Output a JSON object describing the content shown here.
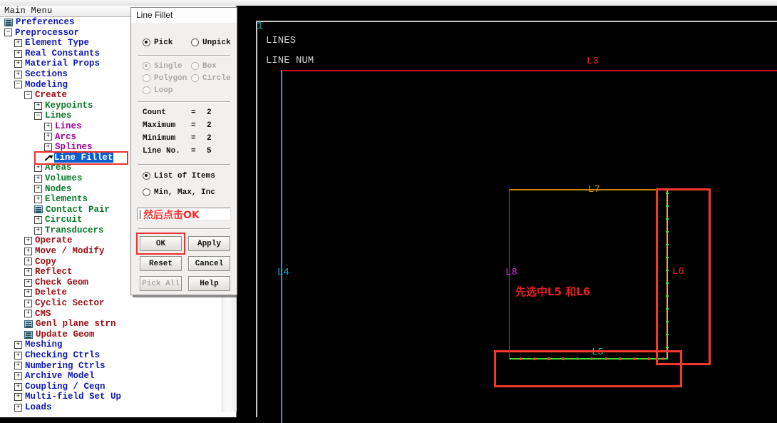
{
  "window": {
    "title": "Main Menu"
  },
  "tree": {
    "title": "Main Menu",
    "items": [
      {
        "label": "Preferences",
        "indent": 0,
        "icon": "module-icon",
        "color": "blue"
      },
      {
        "label": "Preprocessor",
        "indent": 0,
        "icon": "collapse-icon",
        "color": "blue"
      },
      {
        "label": "Element Type",
        "indent": 1,
        "icon": "expand-icon",
        "color": "blue"
      },
      {
        "label": "Real Constants",
        "indent": 1,
        "icon": "expand-icon",
        "color": "blue"
      },
      {
        "label": "Material Props",
        "indent": 1,
        "icon": "expand-icon",
        "color": "blue"
      },
      {
        "label": "Sections",
        "indent": 1,
        "icon": "expand-icon",
        "color": "blue"
      },
      {
        "label": "Modeling",
        "indent": 1,
        "icon": "collapse-icon",
        "color": "blue"
      },
      {
        "label": "Create",
        "indent": 2,
        "icon": "collapse-icon",
        "color": "darkred"
      },
      {
        "label": "Keypoints",
        "indent": 3,
        "icon": "expand-icon",
        "color": "green"
      },
      {
        "label": "Lines",
        "indent": 3,
        "icon": "collapse-icon",
        "color": "green"
      },
      {
        "label": "Lines",
        "indent": 4,
        "icon": "expand-icon",
        "color": "purple"
      },
      {
        "label": "Arcs",
        "indent": 4,
        "icon": "expand-icon",
        "color": "purple"
      },
      {
        "label": "Splines",
        "indent": 4,
        "icon": "expand-icon",
        "color": "purple"
      },
      {
        "label": "Line Fillet",
        "indent": 4,
        "icon": "pick-arrow-icon",
        "color": "purple",
        "selected": true
      },
      {
        "label": "Areas",
        "indent": 3,
        "icon": "expand-icon",
        "color": "green"
      },
      {
        "label": "Volumes",
        "indent": 3,
        "icon": "expand-icon",
        "color": "green"
      },
      {
        "label": "Nodes",
        "indent": 3,
        "icon": "expand-icon",
        "color": "green"
      },
      {
        "label": "Elements",
        "indent": 3,
        "icon": "expand-icon",
        "color": "green"
      },
      {
        "label": "Contact Pair",
        "indent": 3,
        "icon": "module-icon",
        "color": "green"
      },
      {
        "label": "Circuit",
        "indent": 3,
        "icon": "expand-icon",
        "color": "green"
      },
      {
        "label": "Transducers",
        "indent": 3,
        "icon": "expand-icon",
        "color": "green"
      },
      {
        "label": "Operate",
        "indent": 2,
        "icon": "expand-icon",
        "color": "darkred"
      },
      {
        "label": "Move / Modify",
        "indent": 2,
        "icon": "expand-icon",
        "color": "darkred"
      },
      {
        "label": "Copy",
        "indent": 2,
        "icon": "expand-icon",
        "color": "darkred"
      },
      {
        "label": "Reflect",
        "indent": 2,
        "icon": "expand-icon",
        "color": "darkred"
      },
      {
        "label": "Check Geom",
        "indent": 2,
        "icon": "expand-icon",
        "color": "darkred"
      },
      {
        "label": "Delete",
        "indent": 2,
        "icon": "expand-icon",
        "color": "darkred"
      },
      {
        "label": "Cyclic Sector",
        "indent": 2,
        "icon": "expand-icon",
        "color": "darkred"
      },
      {
        "label": "CMS",
        "indent": 2,
        "icon": "expand-icon",
        "color": "darkred"
      },
      {
        "label": "Genl plane strn",
        "indent": 2,
        "icon": "module-icon",
        "color": "darkred"
      },
      {
        "label": "Update Geom",
        "indent": 2,
        "icon": "module-icon",
        "color": "darkred"
      },
      {
        "label": "Meshing",
        "indent": 1,
        "icon": "expand-icon",
        "color": "blue"
      },
      {
        "label": "Checking Ctrls",
        "indent": 1,
        "icon": "expand-icon",
        "color": "blue"
      },
      {
        "label": "Numbering Ctrls",
        "indent": 1,
        "icon": "expand-icon",
        "color": "blue"
      },
      {
        "label": "Archive Model",
        "indent": 1,
        "icon": "expand-icon",
        "color": "blue"
      },
      {
        "label": "Coupling / Ceqn",
        "indent": 1,
        "icon": "expand-icon",
        "color": "blue"
      },
      {
        "label": "Multi-field Set Up",
        "indent": 1,
        "icon": "expand-icon",
        "color": "blue"
      },
      {
        "label": "Loads",
        "indent": 1,
        "icon": "expand-icon",
        "color": "blue"
      }
    ]
  },
  "dialog": {
    "title": "Line Fillet",
    "pick_mode": {
      "pick": "Pick",
      "unpick": "Unpick",
      "selected": "Pick"
    },
    "shape_mode": {
      "single": "Single",
      "box": "Box",
      "polygon": "Polygon",
      "circle": "Circle",
      "loop": "Loop",
      "selected": "Single",
      "disabled": true
    },
    "counters": [
      {
        "label": "Count",
        "eq": "=",
        "value": "2"
      },
      {
        "label": "Maximum",
        "eq": "=",
        "value": "2"
      },
      {
        "label": "Minimum",
        "eq": "=",
        "value": "2"
      },
      {
        "label": "Line No.",
        "eq": "=",
        "value": "5"
      }
    ],
    "list_mode": {
      "list": "List of Items",
      "minmax": "Min, Max, Inc",
      "selected": "List of Items"
    },
    "input": {
      "value": "",
      "annotation": "然后点击OK"
    },
    "buttons": [
      {
        "label": "OK",
        "disabled": false,
        "highlighted": true
      },
      {
        "label": "Apply",
        "disabled": false,
        "highlighted": false
      },
      {
        "label": "Reset",
        "disabled": false,
        "highlighted": false
      },
      {
        "label": "Cancel",
        "disabled": false,
        "highlighted": false
      },
      {
        "label": "Pick All",
        "disabled": true,
        "highlighted": false
      },
      {
        "label": "Help",
        "disabled": false,
        "highlighted": false
      }
    ]
  },
  "graphics": {
    "view_number": "1",
    "header_line_1": "LINES",
    "header_line_2": "LINE NUM",
    "annotation": "先选中L5 和L6",
    "line_labels": [
      {
        "name": "L3",
        "color": "#ff1e1e"
      },
      {
        "name": "L4",
        "color": "#0aa8e8"
      },
      {
        "name": "L5",
        "color": "#00c89a"
      },
      {
        "name": "L6",
        "color": "#ff1e1e"
      },
      {
        "name": "L7",
        "color": "#d79b00"
      },
      {
        "name": "L8",
        "color": "#e81ee8"
      }
    ],
    "colors": {
      "background": "#000000",
      "l3_red": "#d00000",
      "l4_cyan": "#0aa8e8",
      "l5_green": "#4cd137",
      "l6_orange": "#f5a623",
      "l7_gold": "#c98800",
      "l8_magenta": "#c800c8",
      "selection_box": "#f4382e",
      "header_text": "#d2d2d2",
      "view_number": "#00b6b6"
    }
  }
}
